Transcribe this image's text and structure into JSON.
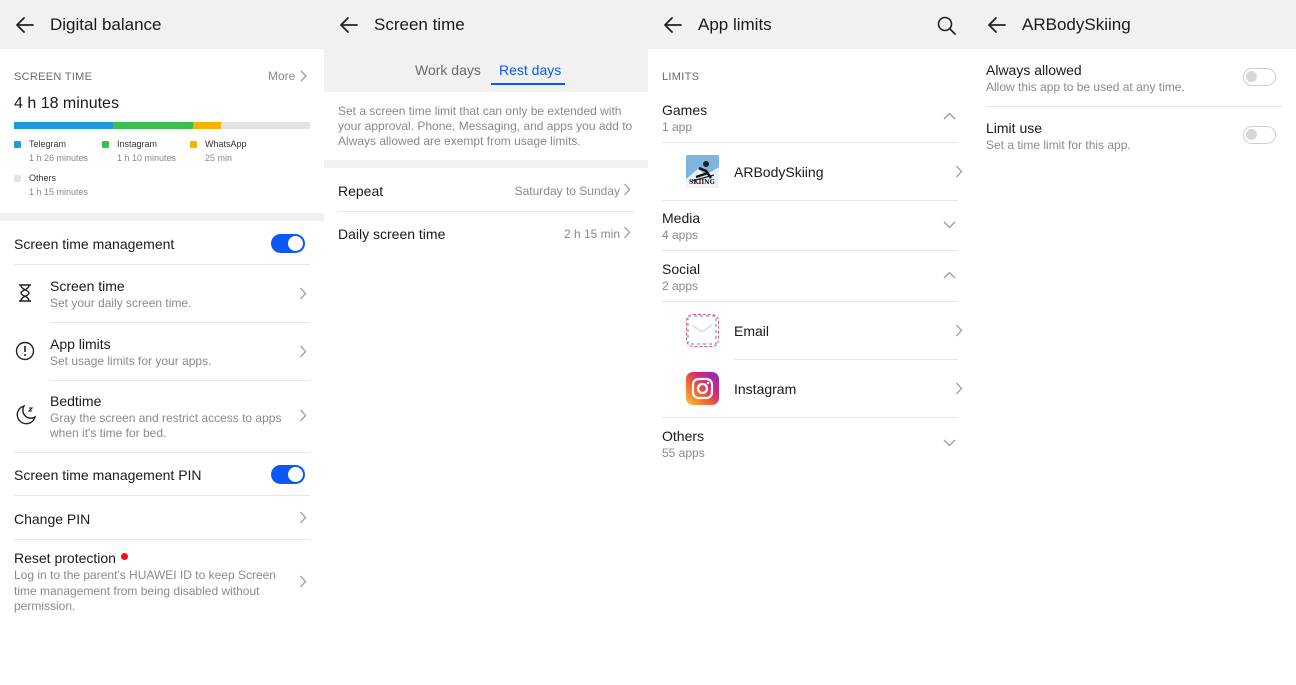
{
  "panel1": {
    "title": "Digital balance",
    "screen_time_label": "SCREEN TIME",
    "more_label": "More",
    "total": "4 h 18 minutes",
    "usage": [
      {
        "name": "Telegram",
        "time": "1 h 26 minutes",
        "color": "#1e9bd9",
        "fraction": 0.333
      },
      {
        "name": "Instagram",
        "time": "1 h 10 minutes",
        "color": "#3bbf4f",
        "fraction": 0.271
      },
      {
        "name": "WhatsApp",
        "time": "25 min",
        "color": "#f5b400",
        "fraction": 0.097
      },
      {
        "name": "Others",
        "time": "1 h 15 minutes",
        "color": "#e3e3e3",
        "fraction": 0.291
      }
    ],
    "management_label": "Screen time management",
    "items": [
      {
        "label": "Screen time",
        "sub": "Set your daily screen time.",
        "icon": "hourglass-icon"
      },
      {
        "label": "App limits",
        "sub": "Set usage limits for your apps.",
        "icon": "alert-circle-icon"
      },
      {
        "label": "Bedtime",
        "sub": "Gray the screen and restrict access to apps when it's time for bed.",
        "icon": "moon-icon"
      }
    ],
    "pin_label": "Screen time management PIN",
    "change_pin_label": "Change PIN",
    "reset_label": "Reset protection",
    "reset_sub": "Log in to the parent's HUAWEI ID to keep Screen time management from being disabled without permission."
  },
  "panel2": {
    "title": "Screen time",
    "tabs": [
      "Work days",
      "Rest days"
    ],
    "active_tab": "Rest days",
    "description": "Set a screen time limit that can only be extended with your approval. Phone, Messaging, and apps you add to Always allowed are exempt from usage limits.",
    "repeat_label": "Repeat",
    "repeat_value": "Saturday to Sunday",
    "daily_label": "Daily screen time",
    "daily_value": "2 h 15 min"
  },
  "panel3": {
    "title": "App limits",
    "section": "LIMITS",
    "groups": {
      "games": {
        "name": "Games",
        "count": "1 app"
      },
      "media": {
        "name": "Media",
        "count": "4 apps"
      },
      "social": {
        "name": "Social",
        "count": "2 apps"
      },
      "others": {
        "name": "Others",
        "count": "55 apps"
      }
    },
    "apps": {
      "arbody": "ARBodySkiing",
      "email": "Email",
      "instagram": "Instagram"
    },
    "skiing_icon_text": "SKIING"
  },
  "panel4": {
    "title": "ARBodySkiing",
    "always_label": "Always allowed",
    "always_sub": "Allow this app to be used at any time.",
    "limit_label": "Limit use",
    "limit_sub": "Set a time limit for this app."
  },
  "colors": {
    "accent": "#0a59f7",
    "header_bg": "#f1f1f1",
    "badge_red": "#e8111a"
  }
}
